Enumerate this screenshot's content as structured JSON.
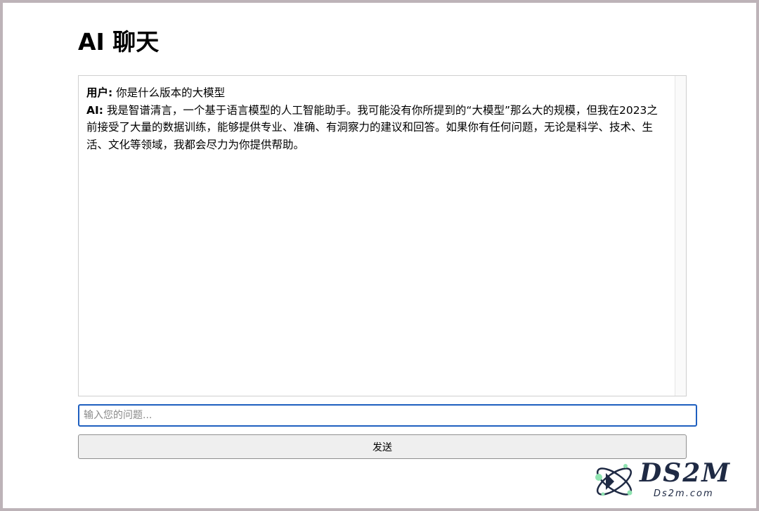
{
  "page": {
    "title": "AI 聊天"
  },
  "chat": {
    "messages": [
      {
        "speaker": "用户:",
        "text": "你是什么版本的大模型"
      },
      {
        "speaker": "AI:",
        "text": "我是智谱清言，一个基于语言模型的人工智能助手。我可能没有你所提到的“大模型”那么大的规模，但我在2023之前接受了大量的数据训练，能够提供专业、准确、有洞察力的建议和回答。如果你有任何问题，无论是科学、技术、生活、文化等领域，我都会尽力为你提供帮助。"
      }
    ]
  },
  "input": {
    "placeholder": "输入您的问题...",
    "value": ""
  },
  "send_button": {
    "label": "发送"
  },
  "watermark": {
    "logo_text": "DS2M",
    "sub_text": "Ds2m.com"
  },
  "colors": {
    "input_focus_border": "#1e5fbf",
    "button_background": "#efefef",
    "watermark_color": "#1f2a44"
  }
}
